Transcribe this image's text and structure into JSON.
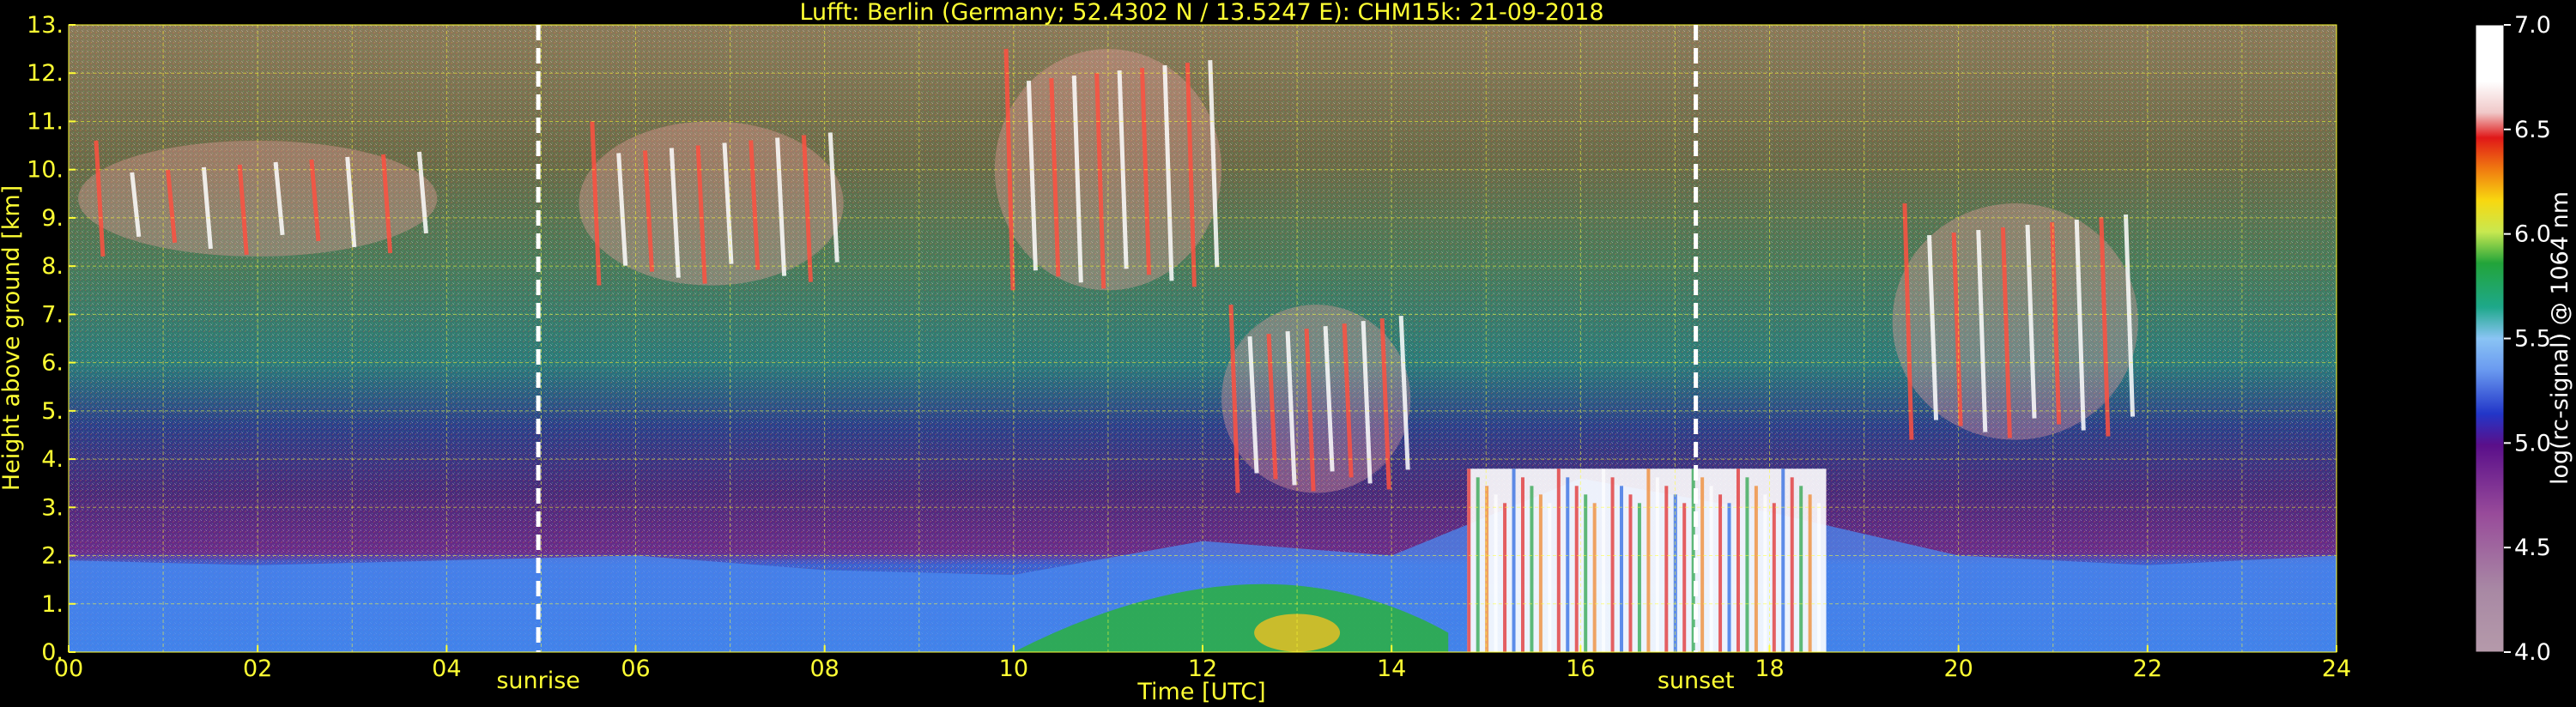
{
  "chart_data": {
    "type": "heatmap",
    "title": "Lufft: Berlin (Germany; 52.4302 N / 13.5247 E):    CHM15k: 21-09-2018",
    "xlabel": "Time [UTC]",
    "ylabel": "Height above ground [km]",
    "xlim": [
      0,
      24
    ],
    "ylim": [
      0,
      13
    ],
    "x_ticks": [
      "00",
      "02",
      "04",
      "06",
      "08",
      "10",
      "12",
      "14",
      "16",
      "18",
      "20",
      "22",
      "24"
    ],
    "y_ticks": [
      "0.",
      "1.",
      "2.",
      "3.",
      "4.",
      "5.",
      "6.",
      "7.",
      "8.",
      "9.",
      "10.",
      "11.",
      "12.",
      "13."
    ],
    "grid": true,
    "annotations": [
      {
        "label": "sunrise",
        "x": 4.97
      },
      {
        "label": "sunset",
        "x": 17.22
      }
    ],
    "colorbar": {
      "label": "log(rc-signal) @ 1064 nm",
      "ticks": [
        "4.0",
        "4.5",
        "5.0",
        "5.5",
        "6.0",
        "6.5",
        "7.0"
      ],
      "range": [
        4.0,
        7.0
      ]
    },
    "features": {
      "boundary_layer": [
        {
          "x": 0,
          "top": 1.9
        },
        {
          "x": 2,
          "top": 1.8
        },
        {
          "x": 4,
          "top": 1.9
        },
        {
          "x": 6,
          "top": 2.0
        },
        {
          "x": 8,
          "top": 1.7
        },
        {
          "x": 10,
          "top": 1.6
        },
        {
          "x": 12,
          "top": 2.3
        },
        {
          "x": 14,
          "top": 2.0
        },
        {
          "x": 16,
          "top": 3.6
        },
        {
          "x": 18,
          "top": 2.9
        },
        {
          "x": 20,
          "top": 2.0
        },
        {
          "x": 22,
          "top": 1.8
        },
        {
          "x": 24,
          "top": 2.0
        }
      ],
      "cloud_layers": [
        {
          "x0": 0.1,
          "x1": 3.9,
          "base": 8.2,
          "top": 10.6
        },
        {
          "x0": 5.4,
          "x1": 8.2,
          "base": 7.6,
          "top": 11.0
        },
        {
          "x0": 9.8,
          "x1": 12.2,
          "base": 7.5,
          "top": 12.5
        },
        {
          "x0": 12.2,
          "x1": 14.2,
          "base": 3.3,
          "top": 7.2
        },
        {
          "x0": 19.3,
          "x1": 21.9,
          "base": 4.4,
          "top": 9.3
        }
      ],
      "dense_low_cloud": [
        {
          "x0": 14.8,
          "x1": 18.6,
          "base": 0.0,
          "top": 3.8
        }
      ]
    }
  }
}
